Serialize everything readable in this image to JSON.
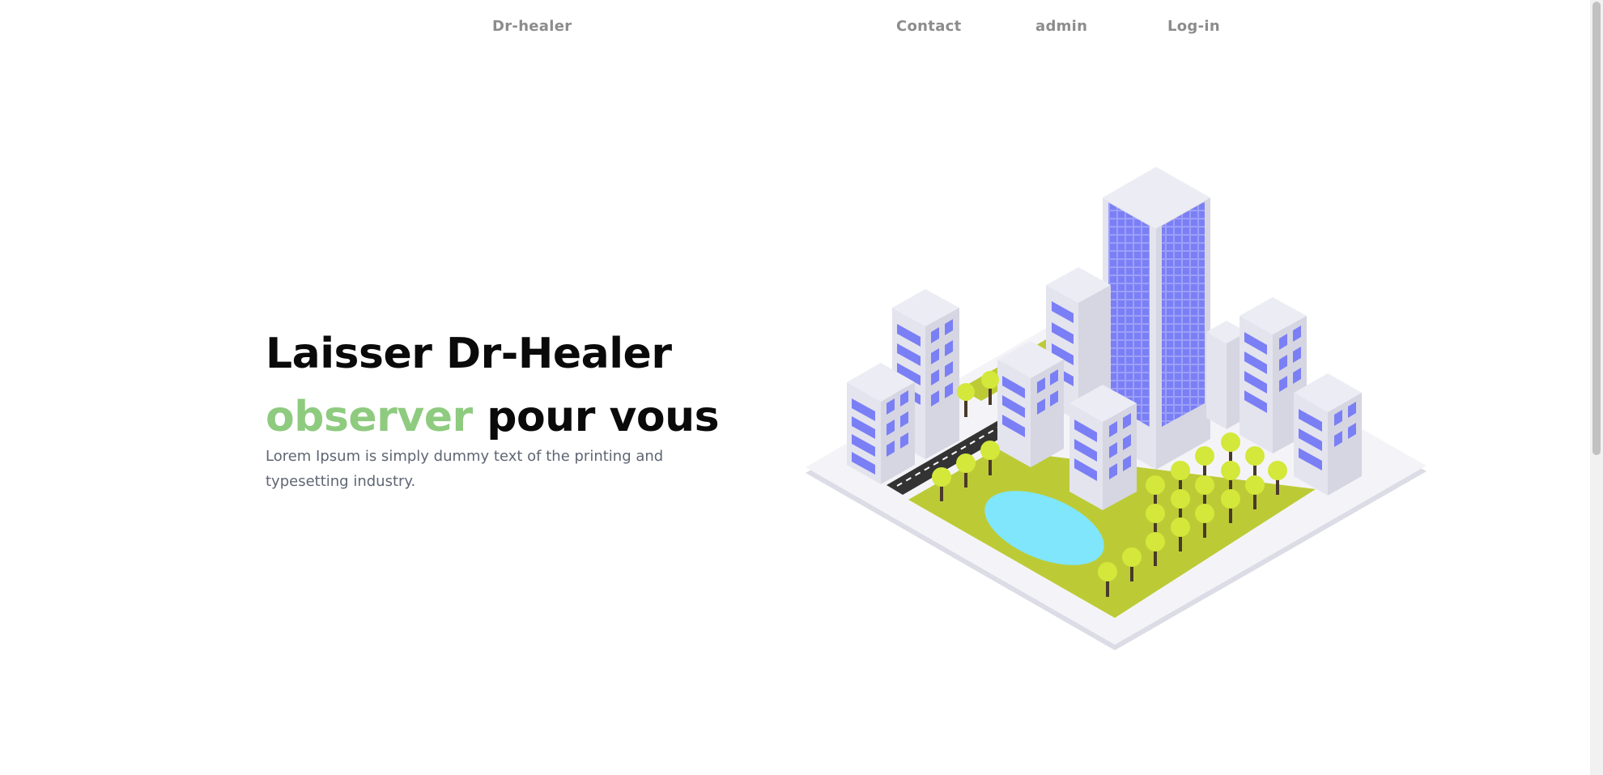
{
  "nav": {
    "brand": "Dr-healer",
    "links": [
      "Contact",
      "admin",
      "Log-in"
    ]
  },
  "hero": {
    "title_line1": "Laisser Dr-Healer",
    "title_accent": "observer",
    "title_rest": " pour vous",
    "description": "Lorem Ipsum is simply dummy text of the printing and typesetting industry."
  },
  "colors": {
    "accent": "#8ecb7f",
    "nav_text": "#8c8c8c",
    "heading": "#0a0a0a",
    "window": "#7b7ff5",
    "grass": "#bccb35",
    "tree": "#d3e83a",
    "water": "#80e6fb"
  }
}
